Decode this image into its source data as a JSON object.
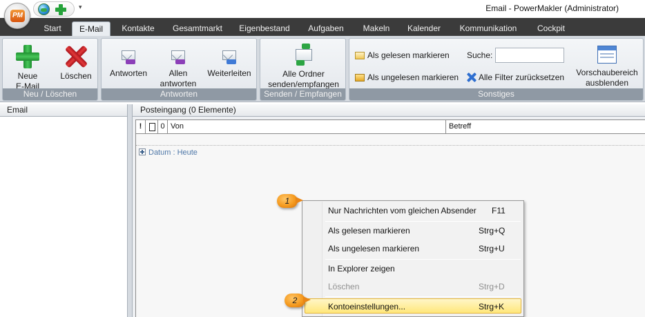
{
  "titlebar": {
    "app_logo": "PM",
    "window_title": "Email - PowerMakler (Administrator)",
    "qat_dropdown": "▾"
  },
  "tabs": [
    "Start",
    "E-Mail",
    "Kontakte",
    "Gesamtmarkt",
    "Eigenbestand",
    "Aufgaben",
    "Makeln",
    "Kalender",
    "Kommunikation",
    "Cockpit"
  ],
  "active_tab": "E-Mail",
  "ribbon": {
    "groups": {
      "neu": {
        "label": "Neu / Löschen",
        "new_email_line1": "Neue",
        "new_email_line2": "E-Mail",
        "delete": "Löschen"
      },
      "antworten": {
        "label": "Antworten",
        "reply": "Antworten",
        "reply_all_line1": "Allen",
        "reply_all_line2": "antworten",
        "forward": "Weiterleiten"
      },
      "senden": {
        "label": "Senden / Empfangen",
        "send_receive_line1": "Alle Ordner",
        "send_receive_line2": "senden/empfangen"
      },
      "sonstiges": {
        "label": "Sonstiges",
        "mark_read": "Als gelesen markieren",
        "mark_unread": "Als ungelesen markieren",
        "search_label": "Suche:",
        "search_value": "",
        "reset_filters": "Alle Filter zurücksetzen",
        "preview_line1": "Vorschaubereich",
        "preview_line2": "ausblenden"
      }
    }
  },
  "left_pane": {
    "header": "Email"
  },
  "right_pane": {
    "header": "Posteingang (0 Elemente)",
    "columns": {
      "importance": "!",
      "attachment": "0",
      "from": "Von",
      "subject": "Betreff"
    },
    "group_row": "Datum : Heute"
  },
  "context_menu": {
    "items": [
      {
        "label": "Nur Nachrichten vom gleichen Absender",
        "shortcut": "F11",
        "disabled": false
      },
      {
        "label": "Als gelesen markieren",
        "shortcut": "Strg+Q",
        "disabled": false
      },
      {
        "label": "Als ungelesen markieren",
        "shortcut": "Strg+U",
        "disabled": false
      },
      {
        "label": "In Explorer zeigen",
        "shortcut": "",
        "disabled": false
      },
      {
        "label": "Löschen",
        "shortcut": "Strg+D",
        "disabled": true
      },
      {
        "label": "Kontoeinstellungen...",
        "shortcut": "Strg+K",
        "disabled": false,
        "highlighted": true
      }
    ]
  },
  "callouts": [
    "1",
    "2"
  ],
  "colors": {
    "tabstrip_bg": "#3b3b3b",
    "ribbon_bg": "#d5dae0",
    "group_label_bg": "#8f99a4",
    "menu_highlight": "#ffe77a",
    "callout_orange": "#f59a1e"
  }
}
